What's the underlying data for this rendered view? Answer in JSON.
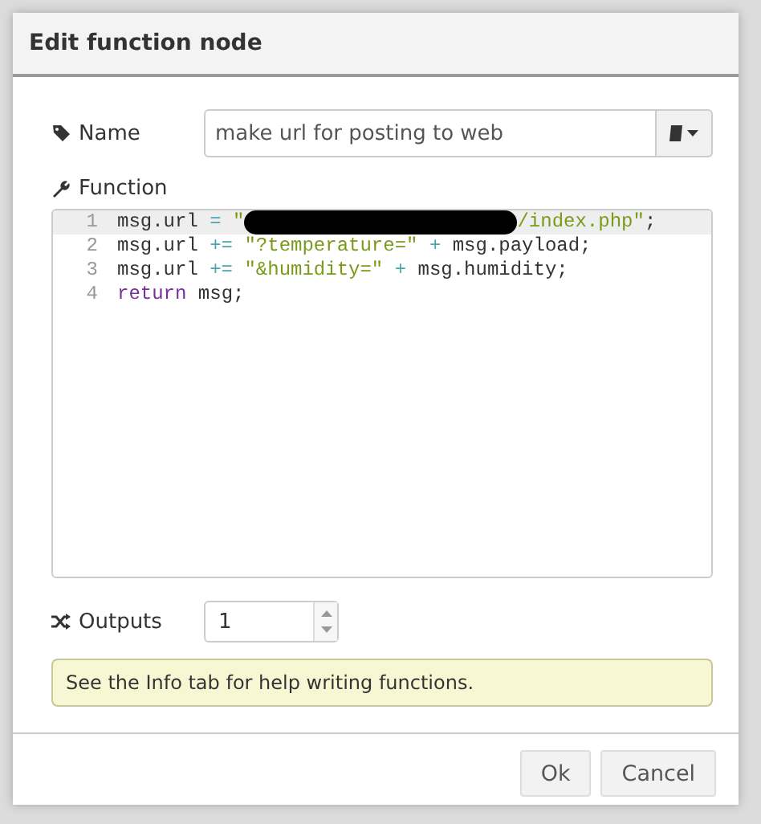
{
  "dialog": {
    "title": "Edit function node"
  },
  "name_field": {
    "label": "Name",
    "value": "make url for posting to web"
  },
  "function_editor": {
    "label": "Function",
    "lines": [
      {
        "number": "1",
        "current": true,
        "tokens": [
          {
            "kind": "plain",
            "text": "msg.url "
          },
          {
            "kind": "operator",
            "text": "= "
          },
          {
            "kind": "string",
            "text": "\""
          },
          {
            "kind": "redaction"
          },
          {
            "kind": "string",
            "text": "/index.php\""
          },
          {
            "kind": "plain",
            "text": ";"
          }
        ]
      },
      {
        "number": "2",
        "current": false,
        "tokens": [
          {
            "kind": "plain",
            "text": "msg.url "
          },
          {
            "kind": "operator",
            "text": "+= "
          },
          {
            "kind": "string",
            "text": "\"?temperature=\" "
          },
          {
            "kind": "operator",
            "text": "+"
          },
          {
            "kind": "plain",
            "text": " msg.payload;"
          }
        ]
      },
      {
        "number": "3",
        "current": false,
        "tokens": [
          {
            "kind": "plain",
            "text": "msg.url "
          },
          {
            "kind": "operator",
            "text": "+= "
          },
          {
            "kind": "string",
            "text": "\"&humidity=\" "
          },
          {
            "kind": "operator",
            "text": "+"
          },
          {
            "kind": "plain",
            "text": " msg.humidity;"
          }
        ]
      },
      {
        "number": "4",
        "current": false,
        "tokens": [
          {
            "kind": "keyword",
            "text": "return"
          },
          {
            "kind": "plain",
            "text": " msg;"
          }
        ]
      }
    ]
  },
  "outputs_field": {
    "label": "Outputs",
    "value": "1"
  },
  "tip": "See the Info tab for help writing functions.",
  "buttons": [
    "Ok",
    "Cancel"
  ]
}
